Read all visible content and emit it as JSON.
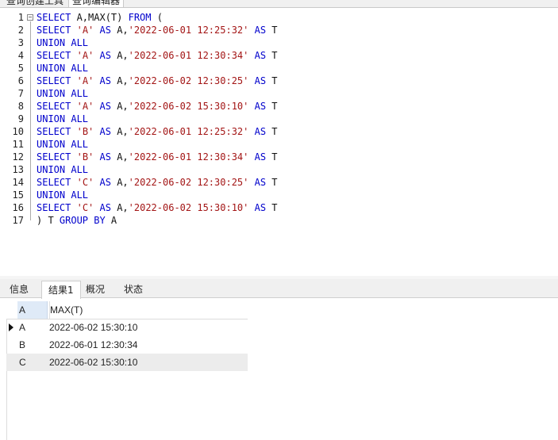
{
  "file_tabs": [
    "查询创建工具",
    "查询编辑器"
  ],
  "editor": {
    "lines": [
      {
        "num": "1",
        "fold": "−",
        "tokens": [
          {
            "t": "kw",
            "v": "SELECT"
          },
          {
            "t": "txt",
            "v": " A,MAX(T) "
          },
          {
            "t": "kw",
            "v": "FROM"
          },
          {
            "t": "txt",
            "v": " ("
          }
        ]
      },
      {
        "num": "2",
        "tokens": [
          {
            "t": "kw",
            "v": "SELECT"
          },
          {
            "t": "txt",
            "v": " "
          },
          {
            "t": "str",
            "v": "'A'"
          },
          {
            "t": "txt",
            "v": " "
          },
          {
            "t": "kw",
            "v": "AS"
          },
          {
            "t": "txt",
            "v": " A,"
          },
          {
            "t": "str",
            "v": "'2022-06-01 12:25:32'"
          },
          {
            "t": "txt",
            "v": " "
          },
          {
            "t": "kw",
            "v": "AS"
          },
          {
            "t": "txt",
            "v": " T"
          }
        ]
      },
      {
        "num": "3",
        "tokens": [
          {
            "t": "kw",
            "v": "UNION ALL"
          }
        ]
      },
      {
        "num": "4",
        "tokens": [
          {
            "t": "kw",
            "v": "SELECT"
          },
          {
            "t": "txt",
            "v": " "
          },
          {
            "t": "str",
            "v": "'A'"
          },
          {
            "t": "txt",
            "v": " "
          },
          {
            "t": "kw",
            "v": "AS"
          },
          {
            "t": "txt",
            "v": " A,"
          },
          {
            "t": "str",
            "v": "'2022-06-01 12:30:34'"
          },
          {
            "t": "txt",
            "v": " "
          },
          {
            "t": "kw",
            "v": "AS"
          },
          {
            "t": "txt",
            "v": " T"
          }
        ]
      },
      {
        "num": "5",
        "tokens": [
          {
            "t": "kw",
            "v": "UNION ALL"
          }
        ]
      },
      {
        "num": "6",
        "tokens": [
          {
            "t": "kw",
            "v": "SELECT"
          },
          {
            "t": "txt",
            "v": " "
          },
          {
            "t": "str",
            "v": "'A'"
          },
          {
            "t": "txt",
            "v": " "
          },
          {
            "t": "kw",
            "v": "AS"
          },
          {
            "t": "txt",
            "v": " A,"
          },
          {
            "t": "str",
            "v": "'2022-06-02 12:30:25'"
          },
          {
            "t": "txt",
            "v": " "
          },
          {
            "t": "kw",
            "v": "AS"
          },
          {
            "t": "txt",
            "v": " T"
          }
        ]
      },
      {
        "num": "7",
        "tokens": [
          {
            "t": "kw",
            "v": "UNION ALL"
          }
        ]
      },
      {
        "num": "8",
        "tokens": [
          {
            "t": "kw",
            "v": "SELECT"
          },
          {
            "t": "txt",
            "v": " "
          },
          {
            "t": "str",
            "v": "'A'"
          },
          {
            "t": "txt",
            "v": " "
          },
          {
            "t": "kw",
            "v": "AS"
          },
          {
            "t": "txt",
            "v": " A,"
          },
          {
            "t": "str",
            "v": "'2022-06-02 15:30:10'"
          },
          {
            "t": "txt",
            "v": " "
          },
          {
            "t": "kw",
            "v": "AS"
          },
          {
            "t": "txt",
            "v": " T"
          }
        ]
      },
      {
        "num": "9",
        "tokens": [
          {
            "t": "kw",
            "v": "UNION ALL"
          }
        ]
      },
      {
        "num": "10",
        "tokens": [
          {
            "t": "kw",
            "v": "SELECT"
          },
          {
            "t": "txt",
            "v": " "
          },
          {
            "t": "str",
            "v": "'B'"
          },
          {
            "t": "txt",
            "v": " "
          },
          {
            "t": "kw",
            "v": "AS"
          },
          {
            "t": "txt",
            "v": " A,"
          },
          {
            "t": "str",
            "v": "'2022-06-01 12:25:32'"
          },
          {
            "t": "txt",
            "v": " "
          },
          {
            "t": "kw",
            "v": "AS"
          },
          {
            "t": "txt",
            "v": " T"
          }
        ]
      },
      {
        "num": "11",
        "tokens": [
          {
            "t": "kw",
            "v": "UNION ALL"
          }
        ]
      },
      {
        "num": "12",
        "tokens": [
          {
            "t": "kw",
            "v": "SELECT"
          },
          {
            "t": "txt",
            "v": " "
          },
          {
            "t": "str",
            "v": "'B'"
          },
          {
            "t": "txt",
            "v": " "
          },
          {
            "t": "kw",
            "v": "AS"
          },
          {
            "t": "txt",
            "v": " A,"
          },
          {
            "t": "str",
            "v": "'2022-06-01 12:30:34'"
          },
          {
            "t": "txt",
            "v": " "
          },
          {
            "t": "kw",
            "v": "AS"
          },
          {
            "t": "txt",
            "v": " T"
          }
        ]
      },
      {
        "num": "13",
        "tokens": [
          {
            "t": "kw",
            "v": "UNION ALL"
          }
        ]
      },
      {
        "num": "14",
        "tokens": [
          {
            "t": "kw",
            "v": "SELECT"
          },
          {
            "t": "txt",
            "v": " "
          },
          {
            "t": "str",
            "v": "'C'"
          },
          {
            "t": "txt",
            "v": " "
          },
          {
            "t": "kw",
            "v": "AS"
          },
          {
            "t": "txt",
            "v": " A,"
          },
          {
            "t": "str",
            "v": "'2022-06-02 12:30:25'"
          },
          {
            "t": "txt",
            "v": " "
          },
          {
            "t": "kw",
            "v": "AS"
          },
          {
            "t": "txt",
            "v": " T"
          }
        ]
      },
      {
        "num": "15",
        "tokens": [
          {
            "t": "kw",
            "v": "UNION ALL"
          }
        ]
      },
      {
        "num": "16",
        "tokens": [
          {
            "t": "kw",
            "v": "SELECT"
          },
          {
            "t": "txt",
            "v": " "
          },
          {
            "t": "str",
            "v": "'C'"
          },
          {
            "t": "txt",
            "v": " "
          },
          {
            "t": "kw",
            "v": "AS"
          },
          {
            "t": "txt",
            "v": " A,"
          },
          {
            "t": "str",
            "v": "'2022-06-02 15:30:10'"
          },
          {
            "t": "txt",
            "v": " "
          },
          {
            "t": "kw",
            "v": "AS"
          },
          {
            "t": "txt",
            "v": " T"
          }
        ]
      },
      {
        "num": "17",
        "tokens": [
          {
            "t": "txt",
            "v": ") T "
          },
          {
            "t": "kw",
            "v": "GROUP BY"
          },
          {
            "t": "txt",
            "v": " A"
          }
        ]
      }
    ]
  },
  "result_tabs": [
    {
      "label": "信息",
      "active": false
    },
    {
      "label": "结果1",
      "active": true
    },
    {
      "label": "概况",
      "active": false
    },
    {
      "label": "状态",
      "active": false
    }
  ],
  "grid": {
    "columns": [
      "A",
      "MAX(T)"
    ],
    "rows": [
      {
        "a": "A",
        "max": "2022-06-02 15:30:10",
        "current": true
      },
      {
        "a": "B",
        "max": "2022-06-01 12:30:34",
        "current": false
      },
      {
        "a": "C",
        "max": "2022-06-02 15:30:10",
        "current": false
      }
    ]
  },
  "colors": {
    "keyword": "#0000cc",
    "string": "#a31515",
    "header_highlight": "#dfeaf7"
  }
}
